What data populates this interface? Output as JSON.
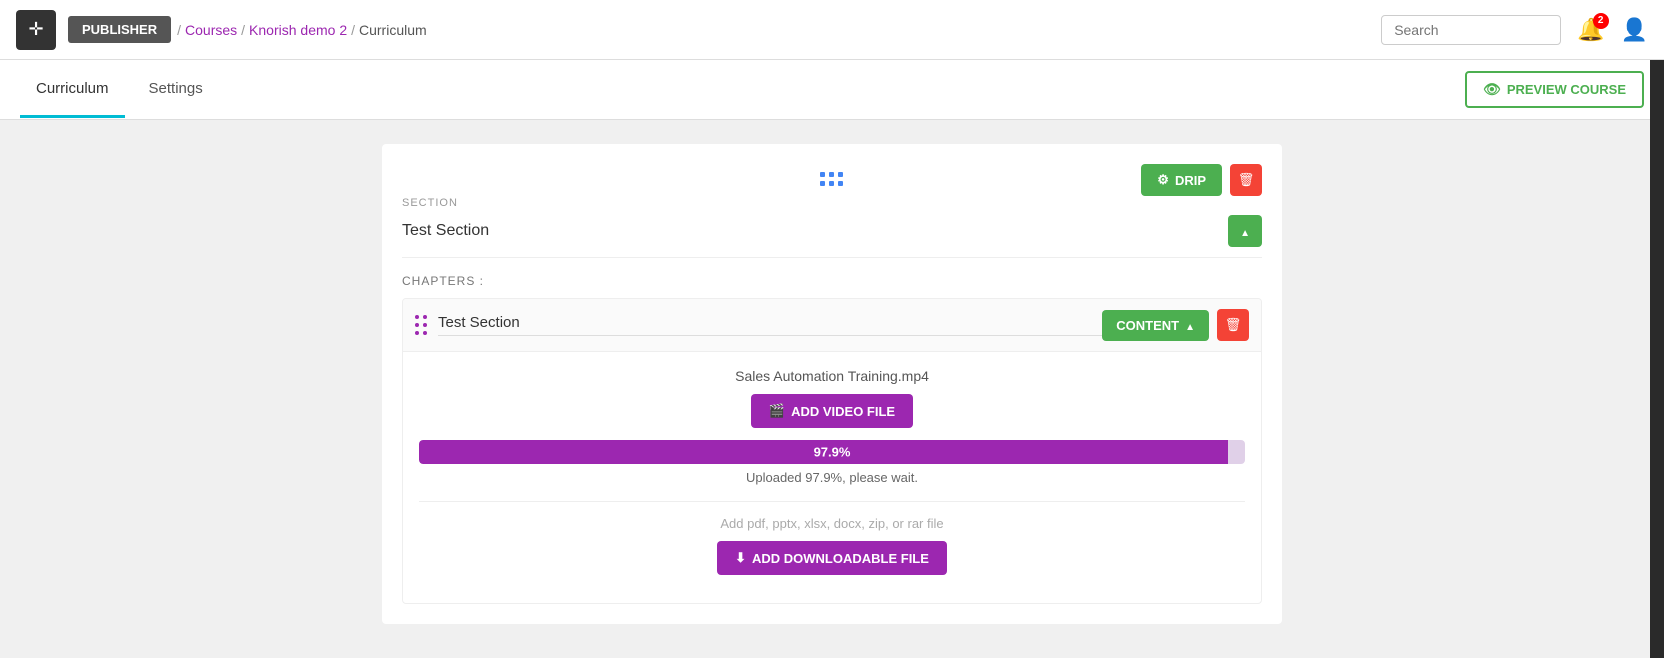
{
  "header": {
    "logo_symbol": "✛",
    "publisher_label": "PUBLISHER",
    "breadcrumb": {
      "courses": "Courses",
      "demo": "Knorish demo 2",
      "current": "Curriculum"
    },
    "search_placeholder": "Search",
    "notif_count": "2",
    "nav_sep": "/"
  },
  "tabs": {
    "curriculum": "Curriculum",
    "settings": "Settings",
    "preview_label": "PREVIEW COURSE"
  },
  "section": {
    "label": "SECTION",
    "name": "Test Section",
    "drip_label": "DRIP",
    "chapters_label": "CHAPTERS :",
    "chapter_name": "Test Section",
    "content_label": "CONTENT",
    "video_filename": "Sales Automation Training.mp4",
    "add_video_label": "ADD VIDEO FILE",
    "progress_pct": "97.9%",
    "progress_value": 97.9,
    "upload_status": "Uploaded 97.9%, please wait.",
    "add_download_hint": "Add pdf, pptx, xlsx, docx, zip, or rar file",
    "add_download_label": "ADD DOWNLOADABLE FILE"
  }
}
